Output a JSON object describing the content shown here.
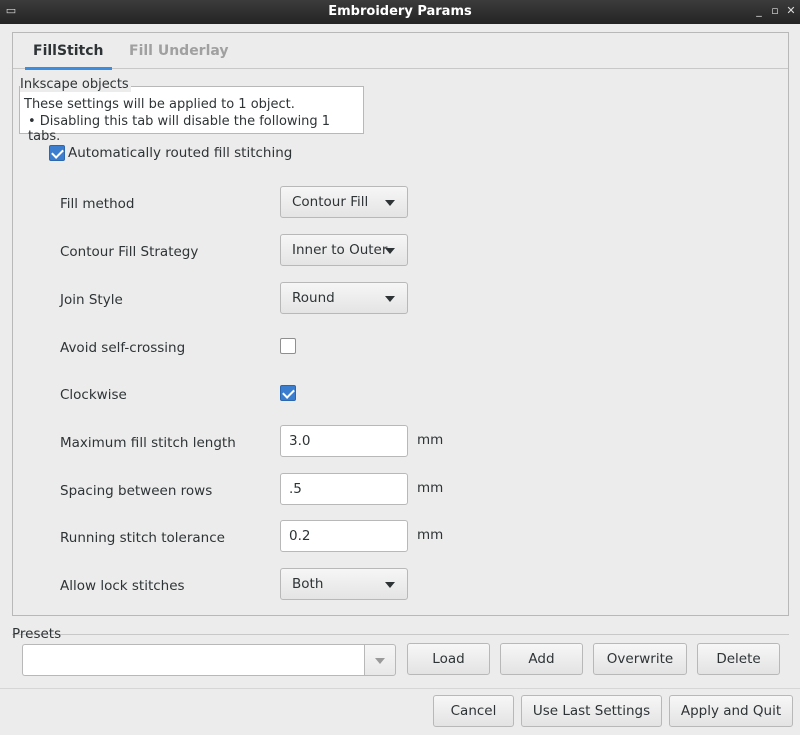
{
  "window": {
    "title": "Embroidery Params",
    "min_glyph": "_",
    "max_glyph": "▫",
    "close_glyph": "✕",
    "menu_glyph": "▭"
  },
  "tabs": [
    {
      "label": "FillStitch",
      "active": true
    },
    {
      "label": "Fill Underlay",
      "active": false
    }
  ],
  "inkscape_objects": {
    "legend": "Inkscape objects",
    "line1": "These settings will be applied to 1 object.",
    "line2": "• Disabling this tab will disable the following 1 tabs."
  },
  "auto_route": {
    "label": "Automatically routed fill stitching",
    "checked": true
  },
  "params": {
    "fill_method": {
      "label": "Fill method",
      "value": "Contour Fill"
    },
    "contour_strategy": {
      "label": "Contour Fill Strategy",
      "value": "Inner to Outer"
    },
    "join_style": {
      "label": "Join Style",
      "value": "Round"
    },
    "avoid_self_crossing": {
      "label": "Avoid self-crossing",
      "checked": false
    },
    "clockwise": {
      "label": "Clockwise",
      "checked": true
    },
    "max_stitch_length": {
      "label": "Maximum fill stitch length",
      "value": "3.0",
      "unit": "mm"
    },
    "row_spacing": {
      "label": "Spacing between rows",
      "value": ".5",
      "unit": "mm"
    },
    "running_tolerance": {
      "label": "Running stitch tolerance",
      "value": "0.2",
      "unit": "mm"
    },
    "lock_stitches": {
      "label": "Allow lock stitches",
      "value": "Both"
    }
  },
  "presets": {
    "legend": "Presets",
    "input_value": "",
    "load": "Load",
    "add": "Add",
    "overwrite": "Overwrite",
    "delete": "Delete"
  },
  "footer": {
    "cancel": "Cancel",
    "use_last": "Use Last Settings",
    "apply_quit": "Apply and Quit"
  }
}
